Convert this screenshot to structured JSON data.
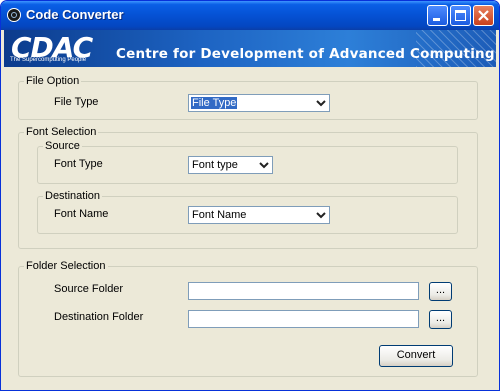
{
  "window": {
    "title": "Code Converter"
  },
  "banner": {
    "logo": "CDAC",
    "tagline": "The Supercomputing People",
    "org": "Centre for Development of Advanced Computing"
  },
  "file_option": {
    "legend": "File Option",
    "file_type_label": "File Type",
    "file_type_value": "File Type"
  },
  "font_selection": {
    "legend": "Font Selection",
    "source": {
      "legend": "Source",
      "font_type_label": "Font Type",
      "font_type_value": "Font type"
    },
    "destination": {
      "legend": "Destination",
      "font_name_label": "Font Name",
      "font_name_value": "Font Name"
    }
  },
  "folder_selection": {
    "legend": "Folder Selection",
    "source_folder_label": "Source Folder",
    "source_folder_value": "",
    "destination_folder_label": "Destination Folder",
    "destination_folder_value": "",
    "browse_label": "...",
    "convert_label": "Convert"
  },
  "colors": {
    "titlebar": "#0553d6",
    "window_bg": "#ece9d8",
    "selection": "#316ac5"
  }
}
